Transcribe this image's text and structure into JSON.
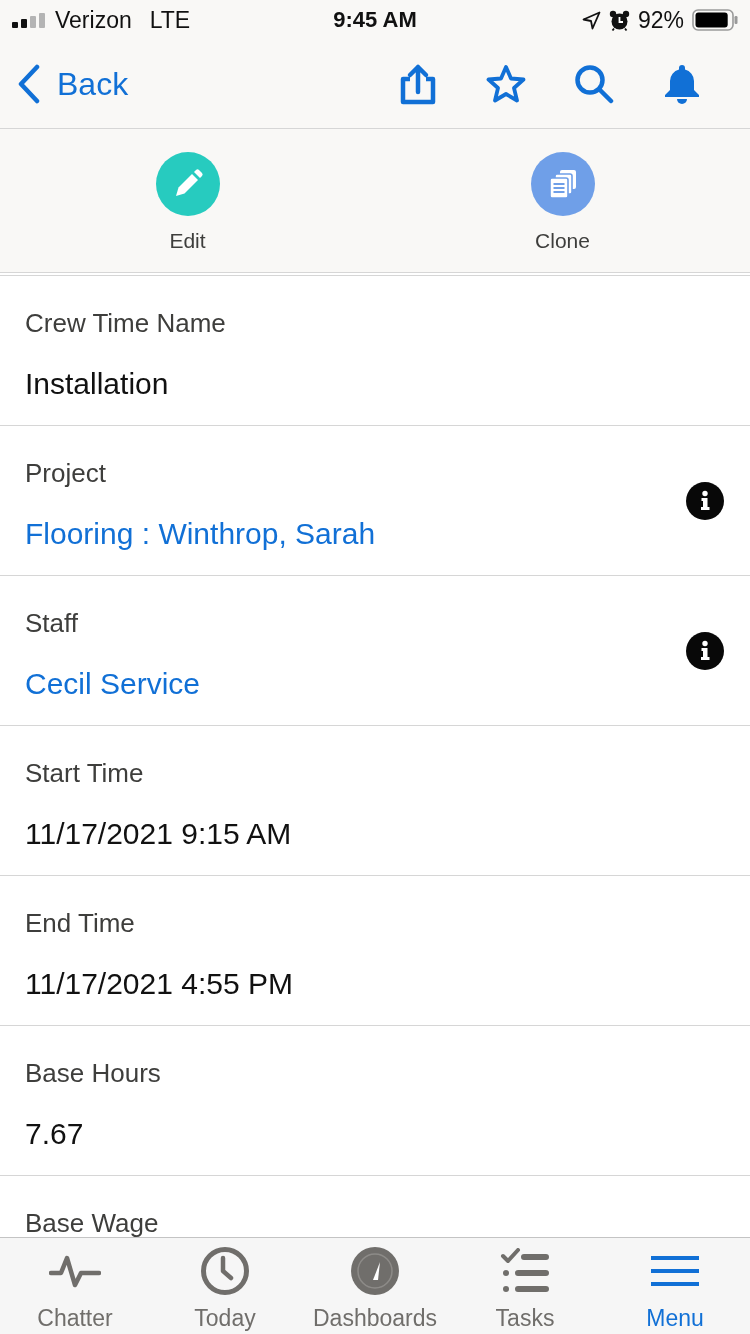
{
  "status_bar": {
    "carrier": "Verizon",
    "network": "LTE",
    "time": "9:45 AM",
    "battery": "92%"
  },
  "nav": {
    "back": "Back"
  },
  "actions": [
    {
      "kind": "edit",
      "label": "Edit",
      "color": "#27cbbf"
    },
    {
      "kind": "clone",
      "label": "Clone",
      "color": "#6f9fe8"
    }
  ],
  "fields": [
    {
      "label": "Crew Time Name",
      "value": "Installation",
      "kind": "text",
      "info": false
    },
    {
      "label": "Project",
      "value": "Flooring : Winthrop, Sarah",
      "kind": "link",
      "info": true
    },
    {
      "label": "Staff",
      "value": "Cecil Service",
      "kind": "link",
      "info": true
    },
    {
      "label": "Start Time",
      "value": "11/17/2021 9:15 AM",
      "kind": "text",
      "info": false
    },
    {
      "label": "End Time",
      "value": "11/17/2021 4:55 PM",
      "kind": "text",
      "info": false
    },
    {
      "label": "Base Hours",
      "value": "7.67",
      "kind": "text",
      "info": false
    },
    {
      "label": "Base Wage"
    }
  ],
  "tab_bar": [
    {
      "label": "Chatter",
      "selected": false
    },
    {
      "label": "Today",
      "selected": false
    },
    {
      "label": "Dashboards",
      "selected": false
    },
    {
      "label": "Tasks",
      "selected": false
    },
    {
      "label": "Menu",
      "selected": true
    }
  ]
}
